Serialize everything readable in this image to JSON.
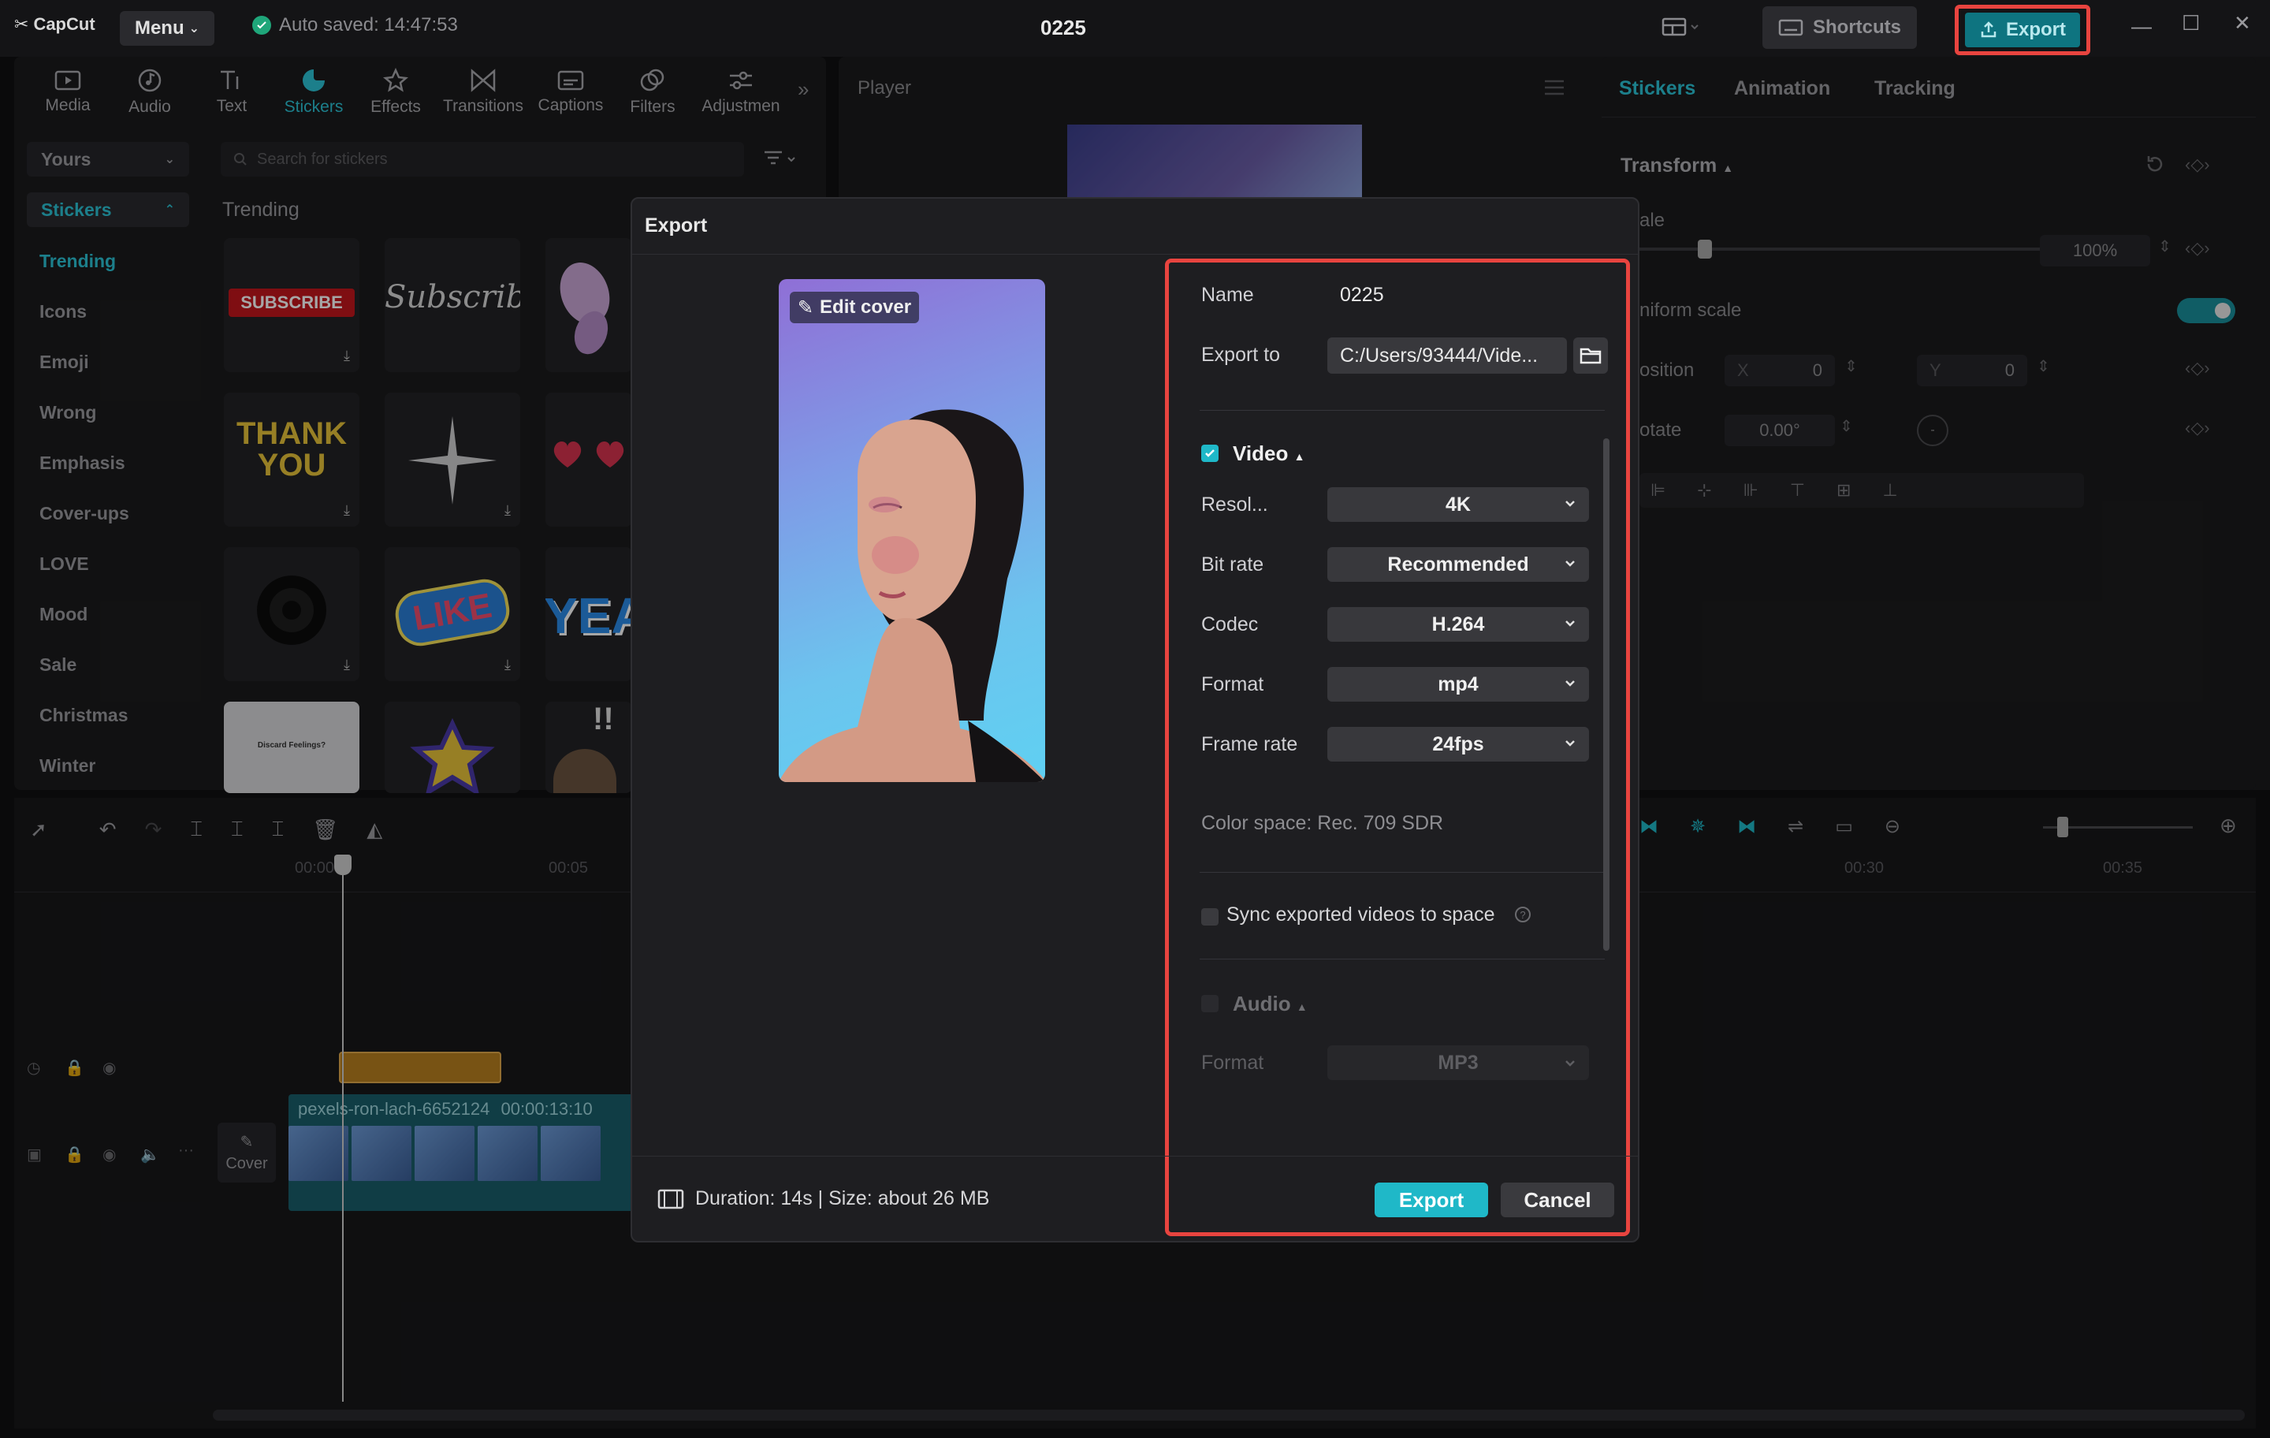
{
  "app": {
    "logo": "CapCut",
    "menu_label": "Menu",
    "autosave": "Auto saved: 14:47:53",
    "project_title": "0225",
    "shortcuts_label": "Shortcuts",
    "export_label": "Export"
  },
  "tool_tabs": [
    {
      "label": "Media",
      "icon": "media-icon"
    },
    {
      "label": "Audio",
      "icon": "audio-icon"
    },
    {
      "label": "Text",
      "icon": "text-icon"
    },
    {
      "label": "Stickers",
      "icon": "stickers-icon"
    },
    {
      "label": "Effects",
      "icon": "effects-icon"
    },
    {
      "label": "Transitions",
      "icon": "transitions-icon"
    },
    {
      "label": "Captions",
      "icon": "captions-icon"
    },
    {
      "label": "Filters",
      "icon": "filters-icon"
    },
    {
      "label": "Adjustmen",
      "icon": "adjustment-icon"
    }
  ],
  "sidebar": {
    "yours": "Yours",
    "stickers": "Stickers",
    "categories": [
      "Trending",
      "Icons",
      "Emoji",
      "Wrong",
      "Emphasis",
      "Cover-ups",
      "LOVE",
      "Mood",
      "Sale",
      "Christmas",
      "Winter"
    ]
  },
  "stickers_panel": {
    "search_placeholder": "Search for stickers",
    "section": "Trending",
    "sticker_texts": [
      "SUBSCRIBE",
      "Subscribe",
      "THANK YOU",
      "LIKE",
      "YEA",
      "!!",
      "Discard Feelings?"
    ]
  },
  "player": {
    "title": "Player"
  },
  "right_panel": {
    "tabs": [
      "Stickers",
      "Animation",
      "Tracking"
    ],
    "transform": "Transform",
    "scale_label": "ale",
    "scale_value": "100%",
    "uniform_label": "niform scale",
    "position_label": "osition",
    "pos_x_label": "X",
    "pos_x": "0",
    "pos_y_label": "Y",
    "pos_y": "0",
    "rotate_label": "otate",
    "rotate_value": "0.00°"
  },
  "timeline": {
    "ticks": [
      "00:00",
      "00:05",
      "00:30",
      "00:35"
    ],
    "clip_name": "pexels-ron-lach-6652124",
    "clip_duration": "00:00:13:10",
    "cover_label": "Cover"
  },
  "dialog": {
    "title": "Export",
    "edit_cover": "Edit cover",
    "name_label": "Name",
    "name_value": "0225",
    "export_to_label": "Export to",
    "export_to_value": "C:/Users/93444/Vide...",
    "video_label": "Video",
    "fields": [
      {
        "label": "Resol...",
        "value": "4K"
      },
      {
        "label": "Bit rate",
        "value": "Recommended"
      },
      {
        "label": "Codec",
        "value": "H.264"
      },
      {
        "label": "Format",
        "value": "mp4"
      },
      {
        "label": "Frame rate",
        "value": "24fps"
      }
    ],
    "color_space": "Color space: Rec. 709 SDR",
    "sync_label": "Sync exported videos to space",
    "help_glyph": "?",
    "audio_label": "Audio",
    "audio_format_label": "Format",
    "audio_format_value": "MP3",
    "footer": "Duration: 14s | Size: about 26 MB",
    "export_button": "Export",
    "cancel_button": "Cancel"
  },
  "colors": {
    "accent": "#1fb8c8",
    "highlight": "#e8443f",
    "background": "#101012"
  }
}
